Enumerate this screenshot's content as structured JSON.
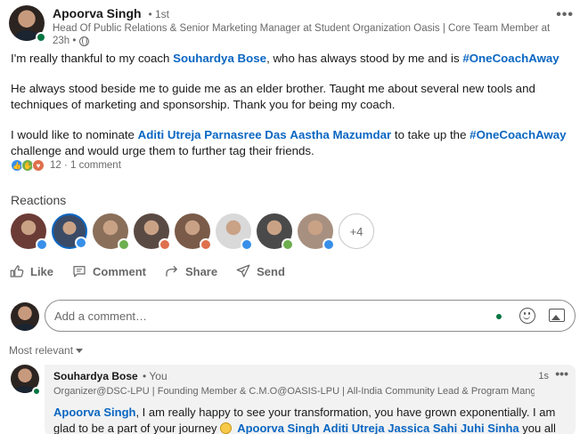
{
  "post": {
    "author": "Apoorva Singh",
    "degree": "• 1st",
    "headline": "Head Of Public Relations & Senior Marketing Manager at Student Organization Oasis | Core Team Member at GeeksforGeeks...",
    "time": "23h •",
    "more_label": "•••",
    "body": {
      "p1_pre": "I'm really thankful to my coach ",
      "p1_mention": "Souhardya Bose",
      "p1_mid": ", who has always stood by me and is ",
      "p1_hashtag": "#OneCoachAway",
      "p2": "He always stood beside me to guide me as an elder brother. Taught me about several new tools and techniques of marketing and sponsorship. Thank you for being my coach.",
      "p3_pre": "I would like to nominate ",
      "p3_mention1": "Aditi Utreja",
      "p3_mention2": "Parnasree Das",
      "p3_mention3": "Aastha Mazumdar",
      "p3_mid": " to take up the ",
      "p3_hashtag": "#OneCoachAway",
      "p3_post": " challenge and would urge them to further tag their friends."
    },
    "social_counts": "12 · 1 comment"
  },
  "reactions": {
    "title": "Reactions",
    "more": "+4",
    "reactors": [
      {
        "bg": "#6b3b35",
        "badge": "#378fe9"
      },
      {
        "bg": "#3b4b66",
        "badge": "#378fe9"
      },
      {
        "bg": "#8a6f5a",
        "badge": "#6dae4f"
      },
      {
        "bg": "#5a4a44",
        "badge": "#df704d"
      },
      {
        "bg": "#7a5a48",
        "badge": "#df704d"
      },
      {
        "bg": "#d9d9d9",
        "badge": "#378fe9"
      },
      {
        "bg": "#4a4a4a",
        "badge": "#6dae4f"
      },
      {
        "bg": "#a89080",
        "badge": "#378fe9"
      }
    ]
  },
  "actions": {
    "like": "Like",
    "comment": "Comment",
    "share": "Share",
    "send": "Send"
  },
  "comment_box": {
    "placeholder": "Add a comment…"
  },
  "sort": {
    "label": "Most relevant"
  },
  "comment": {
    "author": "Souhardya Bose",
    "you": "• You",
    "headline": "Organizer@DSC-LPU | Founding Member & C.M.O@OASIS-LPU | All-India Community Lead & Program Manger@ICSS ...",
    "time": "1s",
    "more_label": "•••",
    "mention1": "Apoorva Singh",
    "text1": ", I am really happy to see your transformation, you have grown exponentially. I am glad to be a part of your journey",
    "mention2": "Apoorva Singh",
    "mention3": "Aditi Utreja",
    "mention4": "Jassica Sahi",
    "mention5": "Juhi Sinha",
    "text2": " you all are amazing, folks."
  },
  "colors": {
    "accent": "#0a66c2",
    "online": "#057642",
    "like": "#378fe9",
    "support": "#6dae4f",
    "love": "#df704d"
  }
}
